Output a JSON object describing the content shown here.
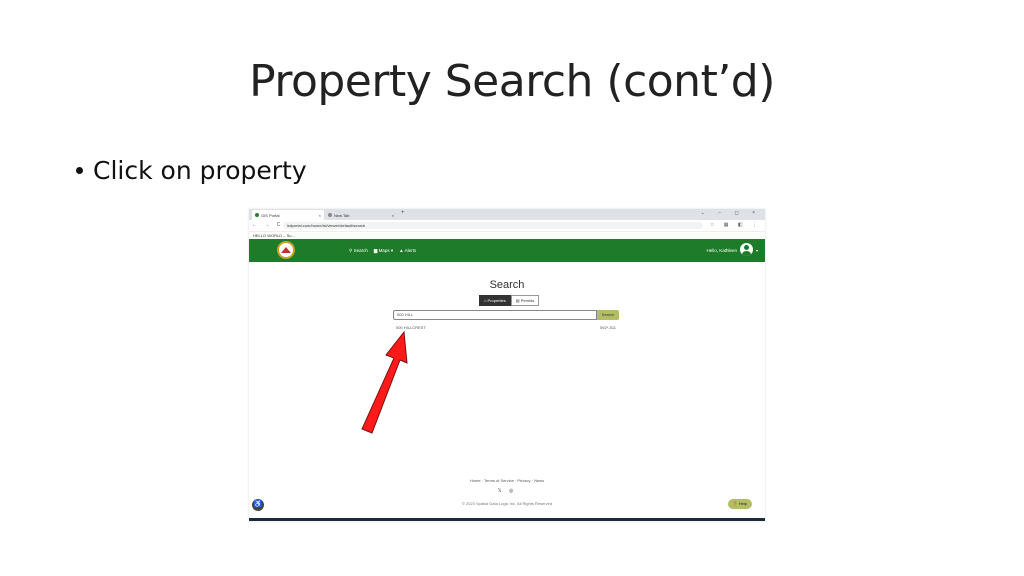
{
  "slide": {
    "title": "Property Search (cont’d)",
    "bullet": "Click on property"
  },
  "browser": {
    "tabs": [
      {
        "label": "GIS Portal",
        "close": "×"
      },
      {
        "label": "New Tab",
        "close": "×"
      }
    ],
    "new_tab": "+",
    "window_controls": "⌄ − ◻ ×",
    "nav_buttons": "← → C",
    "url": "isiiportal.com/home/isi/viewer/default/search",
    "address_icons": "☆ ▦ ◧ ⋮",
    "bookmark": "HELLO WORLD – Su..."
  },
  "site": {
    "nav": [
      "Search",
      "Maps ▾",
      "Alerts"
    ],
    "greeting": "Hello, Kathleen",
    "caret": "▾"
  },
  "search": {
    "title": "Search",
    "toggle": [
      "Properties",
      "Permits"
    ],
    "input_value": "500 HILL",
    "button": "Search",
    "result_address": "500 HILLCREST",
    "result_id": "592*-511"
  },
  "footer": {
    "links": "Home · Terms of Service · Privacy · News",
    "social": "𝕏 ◎",
    "copyright": "© 2023 Spatial Data Logic Inc. All Rights Reserved",
    "help": "❓ Help",
    "accessibility": "♿"
  },
  "colors": {
    "site_green": "#1e7b2a",
    "search_button": "#b3bd64",
    "arrow_red": "#ff1a1a"
  }
}
